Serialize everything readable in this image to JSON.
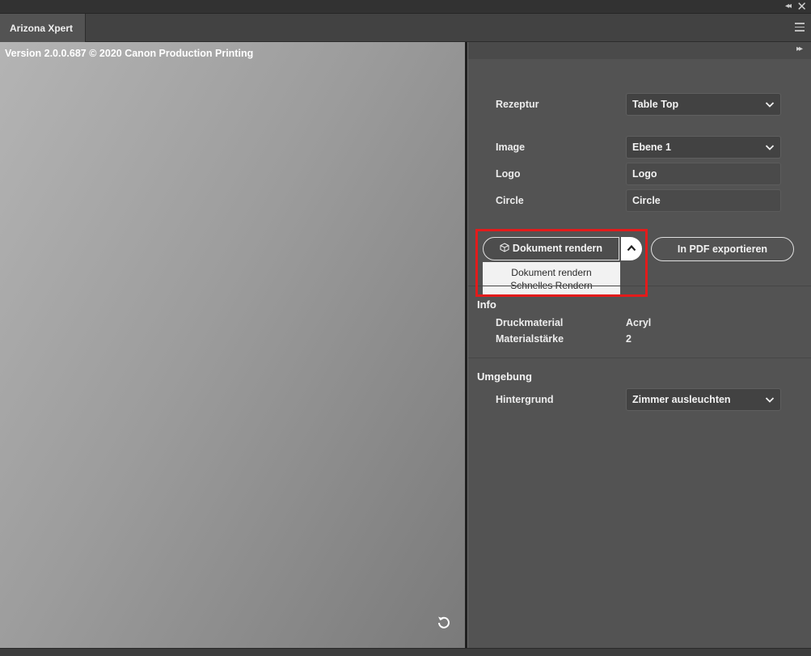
{
  "window": {
    "collapse_glyph": "◂◂",
    "close_glyph": "✕"
  },
  "tabs": [
    {
      "label": "Arizona Xpert"
    }
  ],
  "preview": {
    "version_text": "Version 2.0.0.687 © 2020 Canon Production Printing"
  },
  "panel": {
    "expand_glyph": "▸▸",
    "rezeptur": {
      "label": "Rezeptur",
      "value": "Table Top"
    },
    "image": {
      "label": "Image",
      "value": "Ebene 1"
    },
    "logo": {
      "label": "Logo",
      "value": "Logo"
    },
    "circle": {
      "label": "Circle",
      "value": "Circle"
    },
    "render_button": {
      "label": "Dokument rendern"
    },
    "pdf_button": {
      "label": "In PDF exportieren"
    },
    "render_menu": {
      "items": [
        "Dokument rendern",
        "Schnelles Rendern"
      ]
    },
    "info": {
      "title": "Info",
      "rows": [
        {
          "label": "Druckmaterial",
          "value": "Acryl"
        },
        {
          "label": "Materialstärke",
          "value": "2"
        }
      ]
    },
    "umgebung": {
      "title": "Umgebung",
      "hintergrund": {
        "label": "Hintergrund",
        "value": "Zimmer ausleuchten"
      }
    }
  },
  "colors": {
    "highlight": "#e31b1b",
    "panel_bg": "#535353",
    "input_bg": "#424242"
  }
}
